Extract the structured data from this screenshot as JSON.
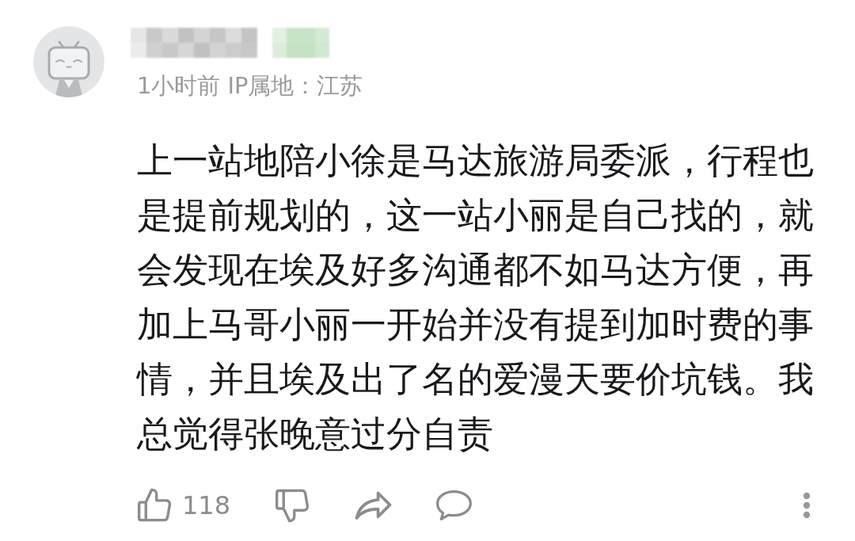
{
  "comment": {
    "time": "1小时前",
    "ip_location": "IP属地：江苏",
    "text": "上一站地陪小徐是马达旅游局委派，行程也是提前规划的，这一站小丽是自己找的，就会发现在埃及好多沟通都不如马达方便，再加上马哥小丽一开始并没有提到加时费的事情，并且埃及出了名的爱漫天要价坑钱。我总觉得张晚意过分自责"
  },
  "actions": {
    "like_count": "118"
  }
}
